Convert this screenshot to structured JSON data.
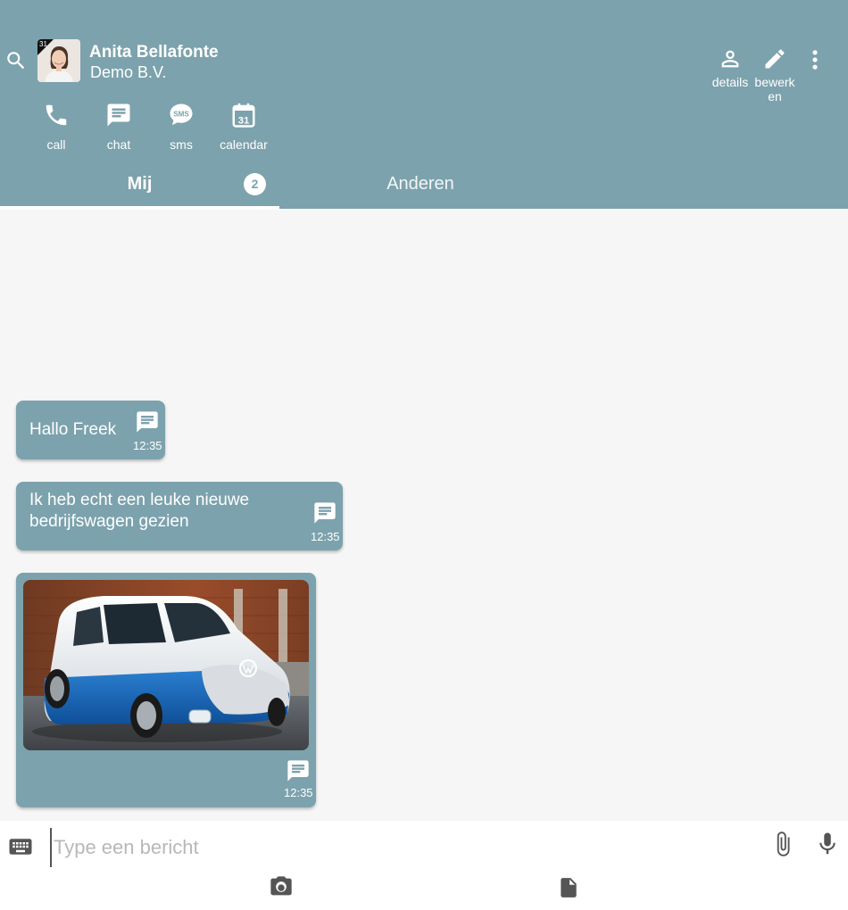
{
  "contact": {
    "name": "Anita Bellafonte",
    "company": "Demo B.V.",
    "avatar_badge": "31"
  },
  "header_actions": [
    {
      "label": "details",
      "icon": "person-icon"
    },
    {
      "label": "bewerk\nen",
      "icon": "pencil-icon"
    }
  ],
  "quick_actions": [
    {
      "label": "call",
      "icon": "phone-icon"
    },
    {
      "label": "chat",
      "icon": "chat-icon"
    },
    {
      "label": "sms",
      "icon": "sms-icon"
    },
    {
      "label": "calendar",
      "icon": "calendar-icon",
      "day": "31"
    }
  ],
  "tabs": [
    {
      "label": "Mij",
      "badge": "2",
      "active": true
    },
    {
      "label": "Anderen",
      "active": false
    }
  ],
  "messages": [
    {
      "text": "Hallo Freek",
      "time": "12:35"
    },
    {
      "text": "Ik heb echt een leuke nieuwe bedrijfswagen gezien",
      "time": "12:35"
    },
    {
      "image": "van-photo",
      "time": "12:35"
    }
  ],
  "composer": {
    "placeholder": "Type een bericht",
    "value": ""
  },
  "colors": {
    "primary": "#7ca2ad",
    "background": "#f6f6f6",
    "composer": "#ffffff",
    "icon_dark": "#555555"
  }
}
